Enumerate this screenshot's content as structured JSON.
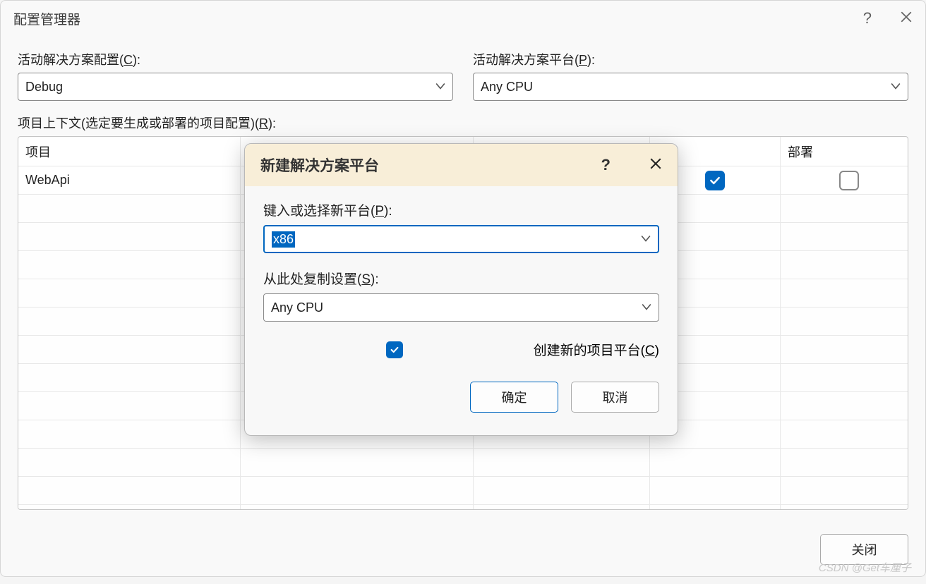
{
  "main": {
    "title": "配置管理器",
    "config_label_pre": "活动解决方案配置(",
    "config_label_u": "C",
    "config_label_post": "):",
    "config_value": "Debug",
    "platform_label_pre": "活动解决方案平台(",
    "platform_label_u": "P",
    "platform_label_post": "):",
    "platform_value": "Any CPU",
    "context_label_pre": "项目上下文(选定要生成或部署的项目配置)(",
    "context_label_u": "R",
    "context_label_post": "):",
    "columns": {
      "project": "项目",
      "deploy": "部署"
    },
    "rows": [
      {
        "project": "WebApi",
        "build_checked": true,
        "deploy_checked": false
      }
    ],
    "close_button": "关闭"
  },
  "modal": {
    "title": "新建解决方案平台",
    "new_platform_label_pre": "键入或选择新平台(",
    "new_platform_label_u": "P",
    "new_platform_label_post": "):",
    "new_platform_value": "x86",
    "copy_from_label_pre": "从此处复制设置(",
    "copy_from_label_u": "S",
    "copy_from_label_post": "):",
    "copy_from_value": "Any CPU",
    "create_checkbox_pre": "创建新的项目平台(",
    "create_checkbox_u": "C",
    "create_checkbox_post": ")",
    "create_checked": true,
    "ok": "确定",
    "cancel": "取消"
  },
  "watermark": "CSDN @Get车厘子"
}
